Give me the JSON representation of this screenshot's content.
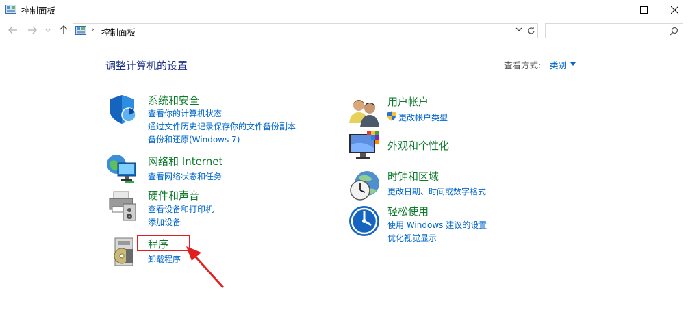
{
  "window": {
    "title": "控制面板"
  },
  "address": {
    "crumb": "控制面板",
    "separator": "›",
    "search_placeholder": ""
  },
  "main": {
    "heading": "调整计算机的设置",
    "view_by_label": "查看方式:",
    "view_by_value": "类别"
  },
  "categories": {
    "system": {
      "title": "系统和安全",
      "links": [
        "查看你的计算机状态",
        "通过文件历史记录保存你的文件备份副本",
        "备份和还原(Windows 7)"
      ]
    },
    "network": {
      "title": "网络和 Internet",
      "links": [
        "查看网络状态和任务"
      ]
    },
    "hardware": {
      "title": "硬件和声音",
      "links": [
        "查看设备和打印机",
        "添加设备"
      ]
    },
    "programs": {
      "title": "程序",
      "links": [
        "卸载程序"
      ]
    },
    "users": {
      "title": "用户帐户",
      "links": [
        "更改帐户类型"
      ]
    },
    "appearance": {
      "title": "外观和个性化",
      "links": []
    },
    "clock": {
      "title": "时钟和区域",
      "links": [
        "更改日期、时间或数字格式"
      ]
    },
    "ease": {
      "title": "轻松使用",
      "links": [
        "使用 Windows 建议的设置",
        "优化视觉显示"
      ]
    }
  },
  "colors": {
    "category_title": "#0a7a2a",
    "link": "#0066cc",
    "heading": "#1e3287",
    "annotation": "#e02020"
  }
}
